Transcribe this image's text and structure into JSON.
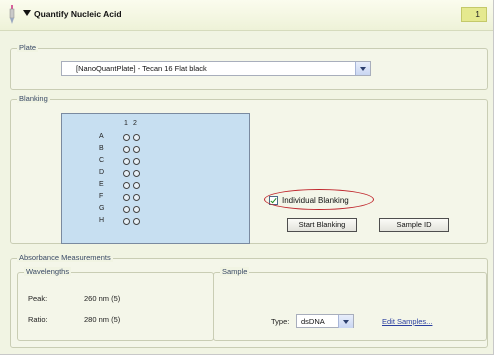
{
  "header": {
    "title": "Quantify Nucleic Acid",
    "step_number": "1"
  },
  "plate": {
    "group_label": "Plate",
    "selected_value": "[NanoQuantPlate] - Tecan 16 Flat black"
  },
  "blanking": {
    "group_label": "Blanking",
    "columns": [
      "1",
      "2"
    ],
    "rows": [
      "A",
      "B",
      "C",
      "D",
      "E",
      "F",
      "G",
      "H"
    ],
    "individual_blanking_label": "Individual Blanking",
    "individual_blanking_checked": true,
    "start_button_label": "Start Blanking",
    "sample_id_button_label": "Sample ID"
  },
  "absorbance": {
    "group_label": "Absorbance Measurements",
    "wavelengths": {
      "group_label": "Wavelengths",
      "peak_label": "Peak:",
      "peak_value": "260 nm (5)",
      "ratio_label": "Ratio:",
      "ratio_value": "280 nm (5)"
    },
    "sample": {
      "group_label": "Sample",
      "type_label": "Type:",
      "type_value": "dsDNA",
      "edit_link_label": "Edit Samples..."
    }
  },
  "colors": {
    "highlight_oval": "#c0272d",
    "plate_map_bg": "#c7dff1",
    "step_badge_bg": "#e5e98f"
  }
}
